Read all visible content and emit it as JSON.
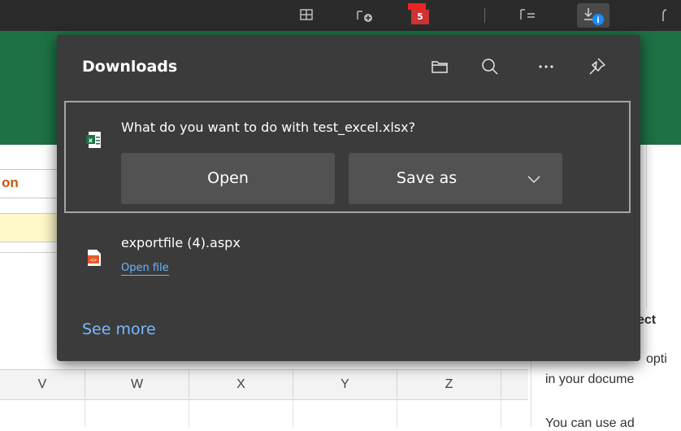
{
  "toolbar": {
    "icons": [
      "collections-icon",
      "add-favorite-icon",
      "calendar-icon",
      "reading-list-icon",
      "downloads-icon"
    ],
    "calendar_badge": "5"
  },
  "downloads": {
    "title": "Downloads",
    "prompt": "What do you want to do with test_excel.xlsx?",
    "open_label": "Open",
    "save_as_label": "Save as",
    "files": [
      {
        "name": "exportfile (4).aspx",
        "action": "Open file"
      }
    ],
    "see_more": "See more"
  },
  "sheet": {
    "header_text": "on",
    "columns": [
      "V",
      "W",
      "X",
      "Y",
      "Z"
    ]
  },
  "side_panel": {
    "lines": [
      "ect",
      "opti",
      "in your docume",
      "You can use ad"
    ]
  },
  "colors": {
    "flyout_bg": "#3b3b3b",
    "button_bg": "#525252",
    "link": "#78b9ff",
    "excel_green": "#1e7145"
  }
}
